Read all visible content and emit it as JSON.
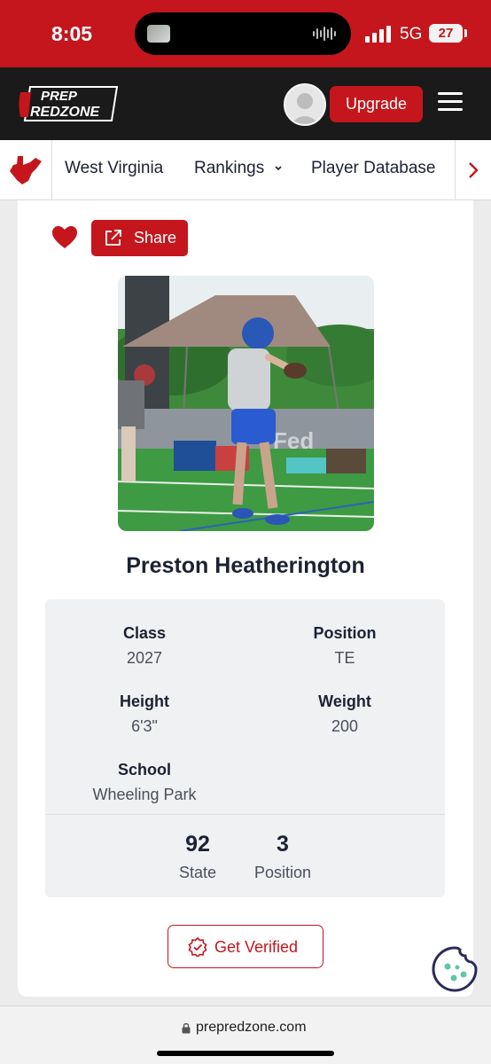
{
  "status_bar": {
    "time": "8:05",
    "network": "5G",
    "battery": "27"
  },
  "header": {
    "logo_line1": "PREP",
    "logo_line2": "REDZONE",
    "upgrade_label": "Upgrade"
  },
  "nav": {
    "state": "West Virginia",
    "rankings": "Rankings",
    "player_database": "Player Database"
  },
  "actions": {
    "share_label": "Share"
  },
  "player": {
    "name": "Preston Heatherington",
    "class_label": "Class",
    "class_value": "2027",
    "position_label": "Position",
    "position_value": "TE",
    "height_label": "Height",
    "height_value": "6'3\"",
    "weight_label": "Weight",
    "weight_value": "200",
    "school_label": "School",
    "school_value": "Wheeling Park"
  },
  "rankings": {
    "state_rank": "92",
    "state_label": "State",
    "position_rank": "3",
    "position_label": "Position"
  },
  "verify": {
    "label": "Get Verified"
  },
  "browser": {
    "url": "prepredzone.com"
  },
  "colors": {
    "brand_red": "#c4161c",
    "header_dark": "#1a1a1a",
    "stats_bg": "#f0f1f3"
  }
}
